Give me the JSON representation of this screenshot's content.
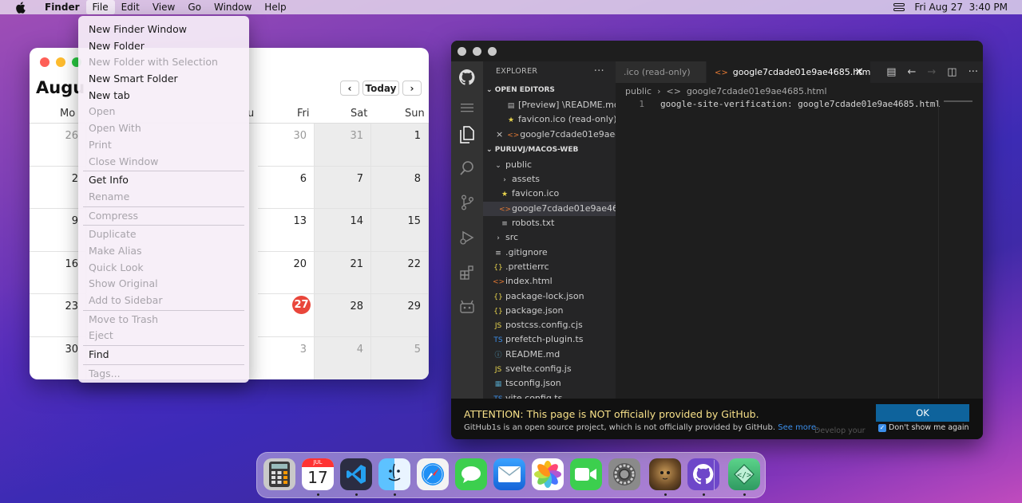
{
  "menubar": {
    "app_name": "Finder",
    "items": [
      "File",
      "Edit",
      "View",
      "Go",
      "Window",
      "Help"
    ],
    "active_item": "File",
    "clock": "Fri Aug 27  3:40 PM"
  },
  "calendar": {
    "title": "Augu",
    "today_label": "Today",
    "prev_label": "‹",
    "next_label": "›",
    "weekdays": [
      "Mo",
      "u",
      "Fri",
      "Sat",
      "Sun"
    ],
    "weeks": [
      [
        "26",
        "",
        "",
        "",
        "30",
        "31",
        "1"
      ],
      [
        "2",
        "",
        "",
        "",
        "6",
        "7",
        "8"
      ],
      [
        "9",
        "",
        "",
        "",
        "13",
        "14",
        "15"
      ],
      [
        "16",
        "",
        "",
        "",
        "20",
        "21",
        "22"
      ],
      [
        "23",
        "",
        "",
        "",
        "27",
        "28",
        "29"
      ],
      [
        "30",
        "",
        "",
        "",
        "3",
        "4",
        "5"
      ]
    ],
    "today_value": "27"
  },
  "file_menu": {
    "items": [
      {
        "label": "New Finder Window",
        "enabled": true
      },
      {
        "label": "New Folder",
        "enabled": true
      },
      {
        "label": "New Folder with Selection",
        "enabled": false
      },
      {
        "label": "New Smart Folder",
        "enabled": true
      },
      {
        "label": "New tab",
        "enabled": true
      },
      {
        "label": "Open",
        "enabled": false
      },
      {
        "label": "Open With",
        "enabled": false
      },
      {
        "label": "Print",
        "enabled": false
      },
      {
        "label": "Close Window",
        "enabled": false
      },
      {
        "sep": true
      },
      {
        "label": "Get Info",
        "enabled": true
      },
      {
        "label": "Rename",
        "enabled": false
      },
      {
        "sep": true
      },
      {
        "label": "Compress",
        "enabled": false
      },
      {
        "sep": true
      },
      {
        "label": "Duplicate",
        "enabled": false
      },
      {
        "label": "Make Alias",
        "enabled": false
      },
      {
        "label": "Quick Look",
        "enabled": false
      },
      {
        "label": "Show Original",
        "enabled": false
      },
      {
        "label": "Add to Sidebar",
        "enabled": false
      },
      {
        "sep": true
      },
      {
        "label": "Move to Trash",
        "enabled": false
      },
      {
        "label": "Eject",
        "enabled": false
      },
      {
        "sep": true
      },
      {
        "label": "Find",
        "enabled": true
      },
      {
        "sep": true
      },
      {
        "label": "Tags...",
        "enabled": false
      }
    ]
  },
  "vscode": {
    "explorer_title": "EXPLORER",
    "more_label": "···",
    "open_editors_title": "OPEN EDITORS",
    "open_editors": [
      {
        "label": "[Preview] \\README.md",
        "icon": "▤",
        "color": "#bbbbbb"
      },
      {
        "label": "favicon.ico (read-only)",
        "icon": "★",
        "color": "#e8d44d"
      },
      {
        "label": "google7cdade01e9ae4...",
        "icon": "<>",
        "color": "#e37933",
        "close": "×"
      }
    ],
    "project_title": "PURUVJ/MACOS-WEB",
    "tree": [
      {
        "label": "public",
        "icon": "⌄",
        "color": "#cccccc",
        "indent": 8
      },
      {
        "label": "assets",
        "icon": "›",
        "color": "#cccccc",
        "indent": 16
      },
      {
        "label": "favicon.ico",
        "icon": "★",
        "color": "#e8d44d",
        "indent": 16
      },
      {
        "label": "google7cdade01e9ae468...",
        "icon": "<>",
        "color": "#e37933",
        "indent": 16,
        "selected": true
      },
      {
        "label": "robots.txt",
        "icon": "≡",
        "color": "#cccccc",
        "indent": 16
      },
      {
        "label": "src",
        "icon": "›",
        "color": "#cccccc",
        "indent": 8
      },
      {
        "label": ".gitignore",
        "icon": "≡",
        "color": "#cccccc",
        "indent": 8
      },
      {
        "label": ".prettierrc",
        "icon": "{}",
        "color": "#e8d44d",
        "indent": 8
      },
      {
        "label": "index.html",
        "icon": "<>",
        "color": "#e37933",
        "indent": 8
      },
      {
        "label": "package-lock.json",
        "icon": "{}",
        "color": "#e8d44d",
        "indent": 8
      },
      {
        "label": "package.json",
        "icon": "{}",
        "color": "#e8d44d",
        "indent": 8
      },
      {
        "label": "postcss.config.cjs",
        "icon": "JS",
        "color": "#e8d44d",
        "indent": 8
      },
      {
        "label": "prefetch-plugin.ts",
        "icon": "TS",
        "color": "#3b8eea",
        "indent": 8
      },
      {
        "label": "README.md",
        "icon": "ⓘ",
        "color": "#519aba",
        "indent": 8
      },
      {
        "label": "svelte.config.js",
        "icon": "JS",
        "color": "#e8d44d",
        "indent": 8
      },
      {
        "label": "tsconfig.json",
        "icon": "▦",
        "color": "#519aba",
        "indent": 8
      },
      {
        "label": "vite.config.ts",
        "icon": "TS",
        "color": "#3b8eea",
        "indent": 8
      }
    ],
    "tab_inactive": ".ico (read-only)",
    "tab_active": "google7cdade01e9ae4685.html",
    "tab_close": "×",
    "breadcrumb": "public  ›  <>  google7cdade01e9ae4685.html",
    "line_number": "1",
    "code_line": "google-site-verification: google7cdade01e9ae4685.html",
    "banner_title": "ATTENTION: This page is NOT officially provided by GitHub.",
    "banner_text": "GitHub1s is an open source project, which is not officially provided by GitHub.",
    "banner_link": "See more.",
    "ok_label": "OK",
    "dont_show_label": "Don't show me again",
    "ghost_status": "Develop your"
  },
  "dock": {
    "calendar_month": "JUL",
    "calendar_day": "17",
    "apps": [
      "Calculator",
      "Calendar",
      "VS Code",
      "Finder",
      "Safari",
      "Messages",
      "Mail",
      "Photos",
      "FaceTime",
      "System Preferences",
      "Purus Twitter",
      "GitHub",
      "Developer"
    ]
  },
  "colors": {
    "close": "#fe5f57",
    "minimize": "#febc2e",
    "zoom": "#28c840",
    "today": "#e9463b",
    "vscode_accent": "#0e639c"
  }
}
